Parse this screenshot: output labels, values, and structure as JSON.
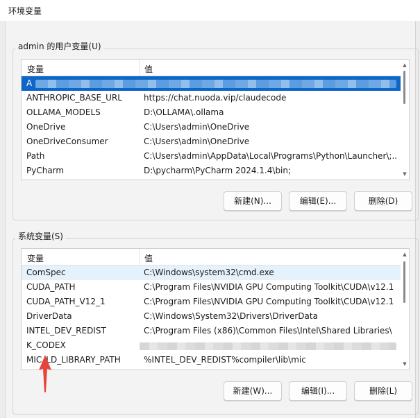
{
  "window": {
    "title": "环境变量"
  },
  "user_vars": {
    "group_label": "admin 的用户变量(U)",
    "columns": {
      "name": "变量",
      "value": "值"
    },
    "rows": [
      {
        "name": "A",
        "value": ""
      },
      {
        "name": "ANTHROPIC_BASE_URL",
        "value": "https://chat.nuoda.vip/claudecode"
      },
      {
        "name": "OLLAMA_MODELS",
        "value": "D:\\OLLAMA\\.ollama"
      },
      {
        "name": "OneDrive",
        "value": "C:\\Users\\admin\\OneDrive"
      },
      {
        "name": "OneDriveConsumer",
        "value": "C:\\Users\\admin\\OneDrive"
      },
      {
        "name": "Path",
        "value": "C:\\Users\\admin\\AppData\\Local\\Programs\\Python\\Launcher\\;..."
      },
      {
        "name": "PyCharm",
        "value": "D:\\pycharm\\PyCharm 2024.1.4\\bin;"
      }
    ],
    "buttons": {
      "new": "新建(N)...",
      "edit": "编辑(E)...",
      "delete": "删除(D)"
    }
  },
  "system_vars": {
    "group_label": "系统变量(S)",
    "columns": {
      "name": "变量",
      "value": "值"
    },
    "rows": [
      {
        "name": "ComSpec",
        "value": "C:\\Windows\\system32\\cmd.exe"
      },
      {
        "name": "CUDA_PATH",
        "value": "C:\\Program Files\\NVIDIA GPU Computing Toolkit\\CUDA\\v12.1"
      },
      {
        "name": "CUDA_PATH_V12_1",
        "value": "C:\\Program Files\\NVIDIA GPU Computing Toolkit\\CUDA\\v12.1"
      },
      {
        "name": "DriverData",
        "value": "C:\\Windows\\System32\\Drivers\\DriverData"
      },
      {
        "name": "INTEL_DEV_REDIST",
        "value": "C:\\Program Files (x86)\\Common Files\\Intel\\Shared Libraries\\"
      },
      {
        "name": "K_CODEX",
        "value": ""
      },
      {
        "name": "MIC_LD_LIBRARY_PATH",
        "value": "%INTEL_DEV_REDIST%compiler\\lib\\mic"
      }
    ],
    "buttons": {
      "new": "新建(W)...",
      "edit": "编辑(I)...",
      "delete": "删除(L)"
    }
  },
  "colors": {
    "selection": "#0e66c8",
    "hover": "#e5f1fb",
    "arrow": "#e8433a"
  }
}
